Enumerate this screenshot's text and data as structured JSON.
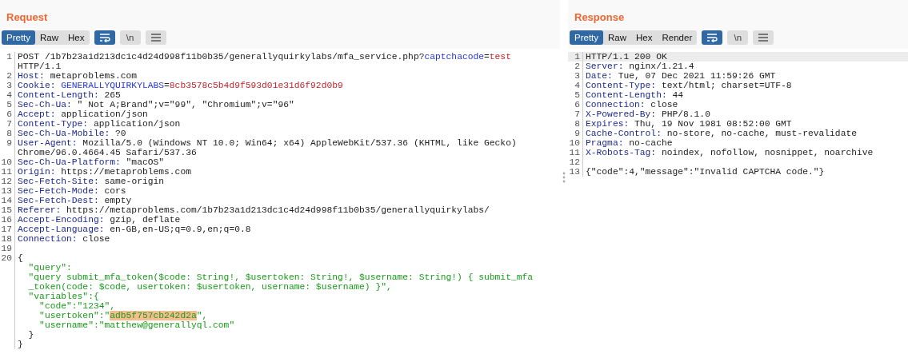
{
  "panels": [
    {
      "title": "Request",
      "tabs": [
        {
          "label": "Pretty",
          "selected": true
        },
        {
          "label": "Raw",
          "selected": false
        },
        {
          "label": "Hex",
          "selected": false
        }
      ],
      "tools": [
        {
          "kind": "wrap",
          "selected": true
        },
        {
          "kind": "newline",
          "label": "\\n",
          "selected": false
        },
        {
          "kind": "menu",
          "selected": false
        }
      ],
      "lines": [
        {
          "number": "1",
          "selected": false,
          "rows": [
            [
              {
                "kind": "plain",
                "text": "POST /1b7b23a1d213dc1c4d24d998f11b0b35/generallyquirkylabs/mfa_service.php?"
              },
              {
                "kind": "param",
                "text": "captchacode"
              },
              {
                "kind": "plain",
                "text": "="
              },
              {
                "kind": "value",
                "text": "test"
              }
            ],
            [
              {
                "kind": "plain",
                "text": "HTTP/1.1"
              }
            ]
          ]
        },
        {
          "number": "2",
          "selected": false,
          "rows": [
            [
              {
                "kind": "key",
                "text": "Host:"
              },
              {
                "kind": "plain",
                "text": " metaproblems.com"
              }
            ]
          ]
        },
        {
          "number": "3",
          "selected": false,
          "rows": [
            [
              {
                "kind": "key",
                "text": "Cookie: "
              },
              {
                "kind": "param",
                "text": "GENERALLYQUIRKYLABS"
              },
              {
                "kind": "plain",
                "text": "="
              },
              {
                "kind": "value",
                "text": "8cb3578c5b4d9f593d01e31d6f92d0b9"
              }
            ]
          ]
        },
        {
          "number": "4",
          "selected": false,
          "rows": [
            [
              {
                "kind": "key",
                "text": "Content-Length:"
              },
              {
                "kind": "plain",
                "text": " 265"
              }
            ]
          ]
        },
        {
          "number": "5",
          "selected": false,
          "rows": [
            [
              {
                "kind": "key",
                "text": "Sec-Ch-Ua:"
              },
              {
                "kind": "plain",
                "text": " \" Not A;Brand\";v=\"99\", \"Chromium\";v=\"96\""
              }
            ]
          ]
        },
        {
          "number": "6",
          "selected": false,
          "rows": [
            [
              {
                "kind": "key",
                "text": "Accept:"
              },
              {
                "kind": "plain",
                "text": " application/json"
              }
            ]
          ]
        },
        {
          "number": "7",
          "selected": false,
          "rows": [
            [
              {
                "kind": "key",
                "text": "Content-Type:"
              },
              {
                "kind": "plain",
                "text": " application/json"
              }
            ]
          ]
        },
        {
          "number": "8",
          "selected": false,
          "rows": [
            [
              {
                "kind": "key",
                "text": "Sec-Ch-Ua-Mobile:"
              },
              {
                "kind": "plain",
                "text": " ?0"
              }
            ]
          ]
        },
        {
          "number": "9",
          "selected": false,
          "rows": [
            [
              {
                "kind": "key",
                "text": "User-Agent:"
              },
              {
                "kind": "plain",
                "text": " Mozilla/5.0 (Windows NT 10.0; Win64; x64) AppleWebKit/537.36 (KHTML, like Gecko)"
              }
            ],
            [
              {
                "kind": "plain",
                "text": "Chrome/96.0.4664.45 Safari/537.36"
              }
            ]
          ]
        },
        {
          "number": "10",
          "selected": false,
          "rows": [
            [
              {
                "kind": "key",
                "text": "Sec-Ch-Ua-Platform:"
              },
              {
                "kind": "plain",
                "text": " \"macOS\""
              }
            ]
          ]
        },
        {
          "number": "11",
          "selected": false,
          "rows": [
            [
              {
                "kind": "key",
                "text": "Origin:"
              },
              {
                "kind": "plain",
                "text": " https://metaproblems.com"
              }
            ]
          ]
        },
        {
          "number": "12",
          "selected": false,
          "rows": [
            [
              {
                "kind": "key",
                "text": "Sec-Fetch-Site:"
              },
              {
                "kind": "plain",
                "text": " same-origin"
              }
            ]
          ]
        },
        {
          "number": "13",
          "selected": false,
          "rows": [
            [
              {
                "kind": "key",
                "text": "Sec-Fetch-Mode:"
              },
              {
                "kind": "plain",
                "text": " cors"
              }
            ]
          ]
        },
        {
          "number": "14",
          "selected": false,
          "rows": [
            [
              {
                "kind": "key",
                "text": "Sec-Fetch-Dest:"
              },
              {
                "kind": "plain",
                "text": " empty"
              }
            ]
          ]
        },
        {
          "number": "15",
          "selected": false,
          "rows": [
            [
              {
                "kind": "key",
                "text": "Referer:"
              },
              {
                "kind": "plain",
                "text": " https://metaproblems.com/1b7b23a1d213dc1c4d24d998f11b0b35/generallyquirkylabs/"
              }
            ]
          ]
        },
        {
          "number": "16",
          "selected": false,
          "rows": [
            [
              {
                "kind": "key",
                "text": "Accept-Encoding:"
              },
              {
                "kind": "plain",
                "text": " gzip, deflate"
              }
            ]
          ]
        },
        {
          "number": "17",
          "selected": false,
          "rows": [
            [
              {
                "kind": "key",
                "text": "Accept-Language:"
              },
              {
                "kind": "plain",
                "text": " en-GB,en-US;q=0.9,en;q=0.8"
              }
            ]
          ]
        },
        {
          "number": "18",
          "selected": false,
          "rows": [
            [
              {
                "kind": "key",
                "text": "Connection:"
              },
              {
                "kind": "plain",
                "text": " close"
              }
            ]
          ]
        },
        {
          "number": "19",
          "selected": false,
          "rows": [
            []
          ]
        },
        {
          "number": "20",
          "selected": false,
          "rows": [
            [
              {
                "kind": "plain",
                "text": "{"
              }
            ],
            [
              {
                "kind": "body",
                "text": "  \"query\":"
              }
            ],
            [
              {
                "kind": "body",
                "text": "  \"query submit_mfa_token($code: String!, $usertoken: String!, $username: String!) { submit_mfa"
              }
            ],
            [
              {
                "kind": "body",
                "text": "  _token(code: $code, usertoken: $usertoken, username: $username) }\","
              }
            ],
            [
              {
                "kind": "body",
                "text": "  \"variables\":{"
              }
            ],
            [
              {
                "kind": "body",
                "text": "    \"code\":\"1234\","
              }
            ],
            [
              {
                "kind": "body",
                "text": "    \"usertoken\":\""
              },
              {
                "kind": "highlight",
                "text": "adb5f757cb242d2a"
              },
              {
                "kind": "body",
                "text": "\","
              }
            ],
            [
              {
                "kind": "body",
                "text": "    \"username\":\"matthew@generallyql.com\""
              }
            ],
            [
              {
                "kind": "plain",
                "text": "  }"
              }
            ],
            [
              {
                "kind": "plain",
                "text": "}"
              }
            ]
          ]
        }
      ]
    },
    {
      "title": "Response",
      "tabs": [
        {
          "label": "Pretty",
          "selected": true
        },
        {
          "label": "Raw",
          "selected": false
        },
        {
          "label": "Hex",
          "selected": false
        },
        {
          "label": "Render",
          "selected": false
        }
      ],
      "tools": [
        {
          "kind": "wrap",
          "selected": true
        },
        {
          "kind": "newline",
          "label": "\\n",
          "selected": false
        },
        {
          "kind": "menu",
          "selected": false
        }
      ],
      "lines": [
        {
          "number": "1",
          "selected": true,
          "rows": [
            [
              {
                "kind": "plain",
                "text": "HTTP/1.1 200 OK"
              }
            ]
          ]
        },
        {
          "number": "2",
          "selected": false,
          "rows": [
            [
              {
                "kind": "key",
                "text": "Server:"
              },
              {
                "kind": "plain",
                "text": " nginx/1.21.4"
              }
            ]
          ]
        },
        {
          "number": "3",
          "selected": false,
          "rows": [
            [
              {
                "kind": "key",
                "text": "Date:"
              },
              {
                "kind": "plain",
                "text": " Tue, 07 Dec 2021 11:59:26 GMT"
              }
            ]
          ]
        },
        {
          "number": "4",
          "selected": false,
          "rows": [
            [
              {
                "kind": "key",
                "text": "Content-Type:"
              },
              {
                "kind": "plain",
                "text": " text/html; charset=UTF-8"
              }
            ]
          ]
        },
        {
          "number": "5",
          "selected": false,
          "rows": [
            [
              {
                "kind": "key",
                "text": "Content-Length:"
              },
              {
                "kind": "plain",
                "text": " 44"
              }
            ]
          ]
        },
        {
          "number": "6",
          "selected": false,
          "rows": [
            [
              {
                "kind": "key",
                "text": "Connection:"
              },
              {
                "kind": "plain",
                "text": " close"
              }
            ]
          ]
        },
        {
          "number": "7",
          "selected": false,
          "rows": [
            [
              {
                "kind": "key",
                "text": "X-Powered-By:"
              },
              {
                "kind": "plain",
                "text": " PHP/8.1.0"
              }
            ]
          ]
        },
        {
          "number": "8",
          "selected": false,
          "rows": [
            [
              {
                "kind": "key",
                "text": "Expires:"
              },
              {
                "kind": "plain",
                "text": " Thu, 19 Nov 1981 08:52:00 GMT"
              }
            ]
          ]
        },
        {
          "number": "9",
          "selected": false,
          "rows": [
            [
              {
                "kind": "key",
                "text": "Cache-Control:"
              },
              {
                "kind": "plain",
                "text": " no-store, no-cache, must-revalidate"
              }
            ]
          ]
        },
        {
          "number": "10",
          "selected": false,
          "rows": [
            [
              {
                "kind": "key",
                "text": "Pragma:"
              },
              {
                "kind": "plain",
                "text": " no-cache"
              }
            ]
          ]
        },
        {
          "number": "11",
          "selected": false,
          "rows": [
            [
              {
                "kind": "key",
                "text": "X-Robots-Tag:"
              },
              {
                "kind": "plain",
                "text": " noindex, nofollow, nosnippet, noarchive"
              }
            ]
          ]
        },
        {
          "number": "12",
          "selected": false,
          "rows": [
            []
          ]
        },
        {
          "number": "13",
          "selected": false,
          "rows": [
            [
              {
                "kind": "plain",
                "text": "{\"code\":4,\"message\":\"Invalid CAPTCHA code.\"}"
              }
            ]
          ]
        }
      ]
    }
  ]
}
